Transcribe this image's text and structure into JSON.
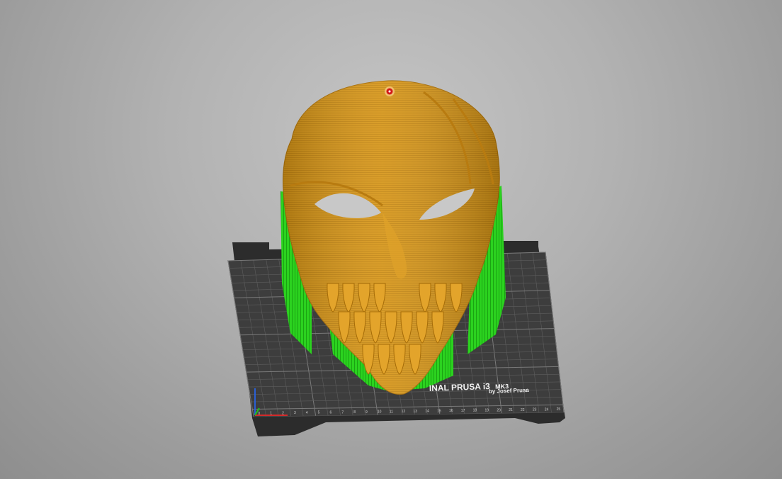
{
  "scene": {
    "type": "3d-slicer-preview",
    "printer": "Original Prusa i3 MK3",
    "object": "mask with supports"
  },
  "bed": {
    "logo_line1": "INAL PRUSA i3",
    "logo_line1_suffix": "MK3",
    "logo_line2": "by Josef Prusa",
    "x_tick_labels": [
      "0",
      "1",
      "2",
      "3",
      "4",
      "5",
      "6",
      "7",
      "8",
      "9",
      "10",
      "11",
      "12",
      "13",
      "14",
      "15",
      "16",
      "17",
      "18",
      "19",
      "20",
      "21",
      "22",
      "23",
      "24",
      "25"
    ]
  },
  "colors": {
    "background_top": "#c4c4c4",
    "background_bottom": "#8e8e8e",
    "bed": "#3c3c3c",
    "bed_grid": "#6a6a6a",
    "model": "#d59418",
    "support": "#22d11a",
    "seam": "#d21a1a",
    "axis_x": "#d42a2a",
    "axis_y": "#2a60d4"
  }
}
